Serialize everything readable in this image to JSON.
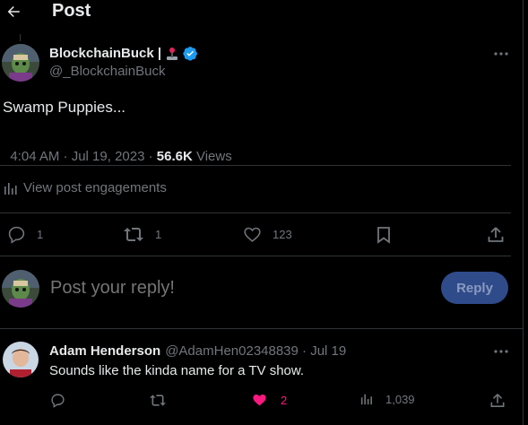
{
  "header": {
    "title": "Post"
  },
  "post": {
    "author_name": "BlockchainBuck |",
    "author_handle": "@_BlockchainBuck",
    "text": "Swamp Puppies...",
    "time": "4:04 AM · Jul 19, 2023 · ",
    "views_count": "56.6K",
    "views_label": " Views",
    "engagements_label": "View post engagements",
    "stats": {
      "replies": "1",
      "reposts": "1",
      "likes": "123"
    }
  },
  "composer": {
    "placeholder": "Post your reply!",
    "reply_label": "Reply"
  },
  "reply": {
    "author_name": "Adam Henderson",
    "author_meta": "@AdamHen02348839 · Jul 19",
    "text": "Sounds like the kinda name for a TV show.",
    "likes": "2",
    "views": "1,039"
  },
  "colors": {
    "accent": "#1d9bf0",
    "like_pink": "#f91880",
    "reply_button_bg": "#2f4b8a"
  }
}
